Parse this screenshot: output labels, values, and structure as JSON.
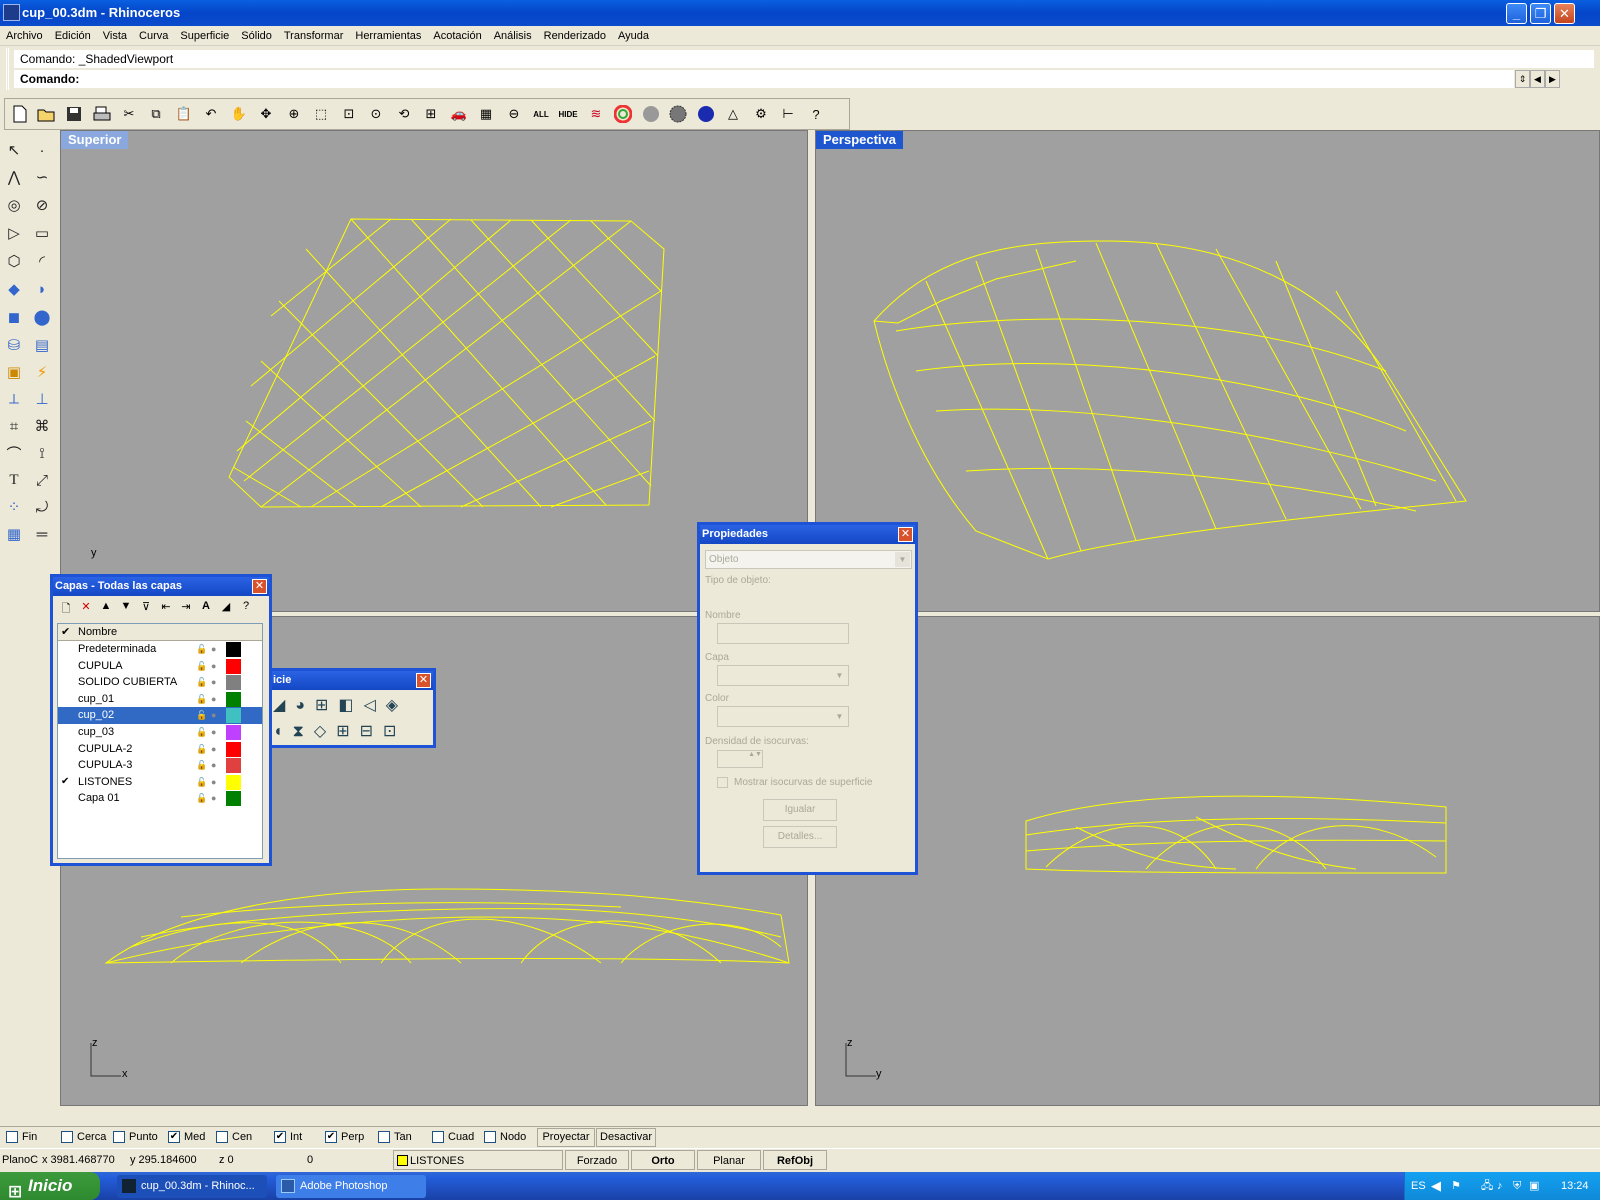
{
  "window": {
    "title": "cup_00.3dm - Rhinoceros"
  },
  "menu": [
    "Archivo",
    "Edición",
    "Vista",
    "Curva",
    "Superficie",
    "Sólido",
    "Transformar",
    "Herramientas",
    "Acotación",
    "Análisis",
    "Renderizado",
    "Ayuda"
  ],
  "command": {
    "history": "Comando: _ShadedViewport",
    "prompt": "Comando:"
  },
  "viewports": {
    "top": "Superior",
    "perspective": "Perspectiva"
  },
  "toolbar_labels": {
    "all": "ALL",
    "hide": "HIDE"
  },
  "layers_panel": {
    "title": "Capas - Todas las capas",
    "column_name": "Nombre",
    "layers": [
      {
        "name": "Predeterminada",
        "color": "#000000",
        "current": false,
        "selected": false
      },
      {
        "name": "CUPULA",
        "color": "#ff0000",
        "current": false,
        "selected": false
      },
      {
        "name": "SOLIDO CUBIERTA",
        "color": "#808080",
        "current": false,
        "selected": false
      },
      {
        "name": "cup_01",
        "color": "#008000",
        "current": false,
        "selected": false
      },
      {
        "name": "cup_02",
        "color": "#40c0c0",
        "current": false,
        "selected": true
      },
      {
        "name": "cup_03",
        "color": "#c040ff",
        "current": false,
        "selected": false
      },
      {
        "name": "CUPULA-2",
        "color": "#ff0000",
        "current": false,
        "selected": false
      },
      {
        "name": "CUPULA-3",
        "color": "#e04040",
        "current": false,
        "selected": false
      },
      {
        "name": "LISTONES",
        "color": "#ffff00",
        "current": true,
        "selected": false
      },
      {
        "name": "Capa 01",
        "color": "#008000",
        "current": false,
        "selected": false
      }
    ]
  },
  "surface_toolbar": {
    "title": "icie"
  },
  "properties_panel": {
    "title": "Propiedades",
    "type_select": "Objeto",
    "object_type_label": "Tipo de objeto:",
    "name_label": "Nombre",
    "layer_label": "Capa",
    "color_label": "Color",
    "density_label": "Densidad de isocurvas:",
    "show_iso_label": "Mostrar isocurvas de superficie",
    "match_button": "Igualar",
    "details_button": "Detalles..."
  },
  "osnaps": [
    {
      "label": "Fin",
      "checked": false
    },
    {
      "label": "Cerca",
      "checked": false
    },
    {
      "label": "Punto",
      "checked": false
    },
    {
      "label": "Med",
      "checked": true
    },
    {
      "label": "Cen",
      "checked": false
    },
    {
      "label": "Int",
      "checked": true
    },
    {
      "label": "Perp",
      "checked": true
    },
    {
      "label": "Tan",
      "checked": false
    },
    {
      "label": "Cuad",
      "checked": false
    },
    {
      "label": "Nodo",
      "checked": false
    }
  ],
  "osnap_buttons": {
    "project": "Proyectar",
    "disable": "Desactivar"
  },
  "status": {
    "plane": "PlanoC",
    "x": "x 3981.468770",
    "y": "y 295.184600",
    "z": "z 0",
    "extra": "0",
    "layer": "LISTONES",
    "layer_color": "#ffff00",
    "snap": "Forzado",
    "ortho": "Orto",
    "planar": "Planar",
    "osnap": "RefObj"
  },
  "axes": {
    "top_y": "y",
    "front_z": "z",
    "front_x": "x",
    "right_z": "z",
    "right_y": "y"
  },
  "taskbar": {
    "start": "Inicio",
    "tasks": [
      "cup_00.3dm - Rhinoc...",
      "Adobe Photoshop"
    ],
    "lang": "ES",
    "time": "13:24"
  },
  "wire_color": "#ffff00",
  "icons": [
    "new-file-icon",
    "open-icon",
    "save-icon",
    "print-icon",
    "cut-icon",
    "copy-icon",
    "paste-icon",
    "undo-icon",
    "pan-icon",
    "rotate-view-icon",
    "zoom-icon",
    "zoom-window-icon",
    "zoom-extents-icon",
    "zoom-selected-icon",
    "undo-view-icon",
    "four-viewports-icon",
    "car-icon",
    "grid-icon",
    "options-icon",
    "layers-icon",
    "color-wheel-icon",
    "shaded-sphere-icon",
    "render-sphere-icon",
    "blue-sphere-icon",
    "light-icon",
    "settings-gear-icon",
    "dimension-icon",
    "help-icon"
  ]
}
